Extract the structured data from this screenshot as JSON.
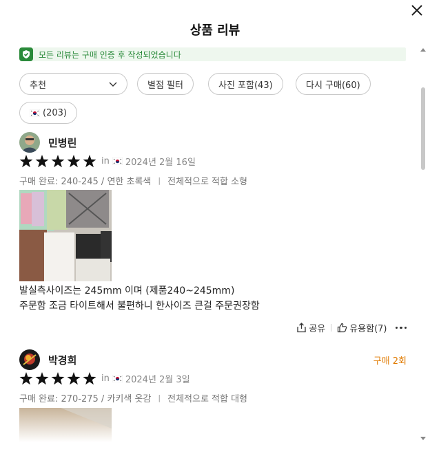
{
  "header": {
    "title": "상품 리뷰"
  },
  "notice": {
    "text": "모든 리뷰는 구매 인증 후 작성되었습니다"
  },
  "filters": {
    "sort": "추천",
    "rating": "별점 필터",
    "photo": "사진 포함(43)",
    "repurchase": "다시 구매(60)",
    "country": "(203)"
  },
  "reviews": [
    {
      "name": "민병린",
      "rating": 5,
      "in_label": "in",
      "date": "2024년 2월 16일",
      "purchase": "구매 완료: 240-245 / 연한 초록색",
      "fit": "전체적으로 적합 소형",
      "text_line1": "발실측사이즈는 245mm 이며 (제품240~245mm)",
      "text_line2": "주문함 조금 타이트해서 불편하니 한사이즈 큰걸 주문권장함",
      "share": "공유",
      "helpful": "유용함(7)"
    },
    {
      "name": "박경희",
      "repurchase_badge": "구매 2회",
      "rating": 5,
      "in_label": "in",
      "date": "2024년 2월 3일",
      "purchase": "구매 완료: 270-275 / 카키색 옷감",
      "fit": "전체적으로 적합 대형"
    }
  ],
  "colors": {
    "accent_green": "#2a8a3a",
    "repurchase_orange": "#e07a00"
  }
}
